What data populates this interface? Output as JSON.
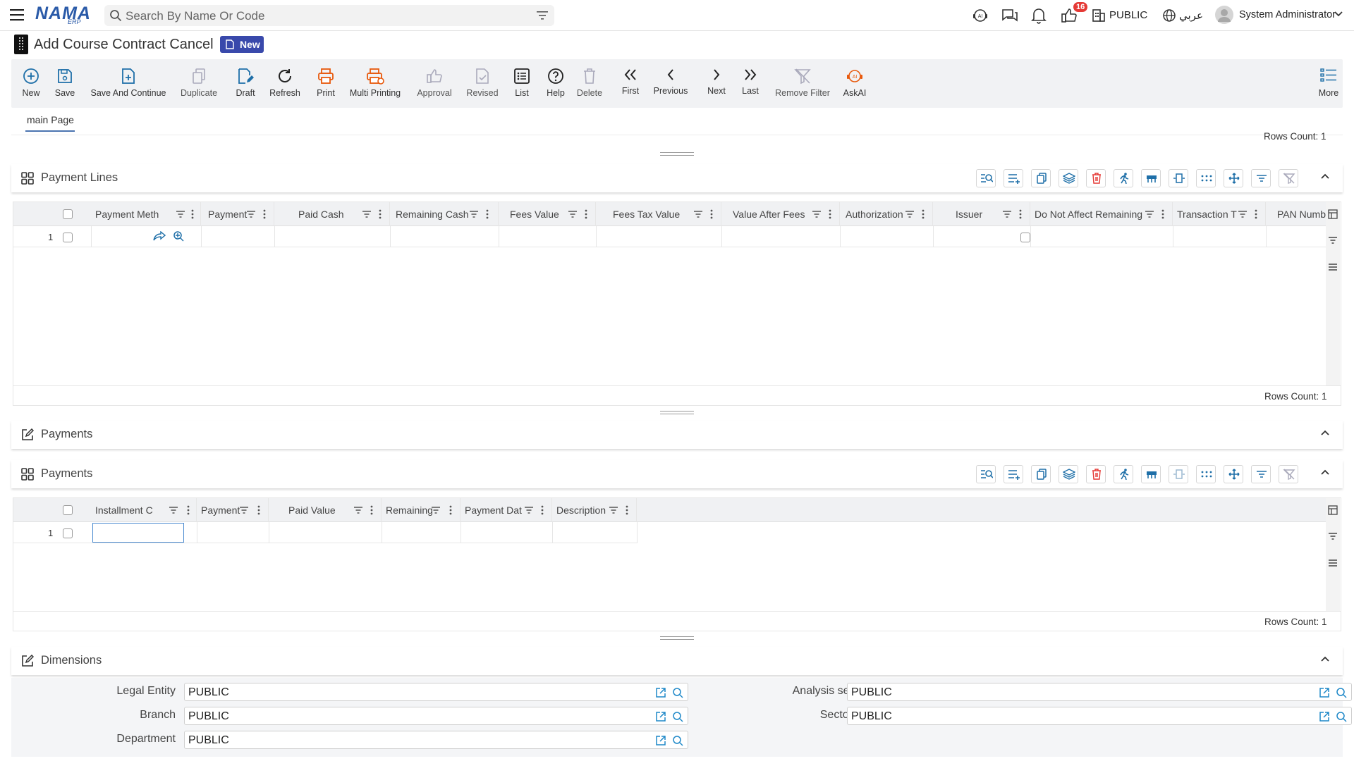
{
  "topbar": {
    "brand": "NAMA",
    "brand_sub": "ERP",
    "search_placeholder": "Search By Name Or Code",
    "notifications_count": "16",
    "company": "PUBLIC",
    "language": "عربي",
    "user": "System Administrator"
  },
  "page": {
    "title": "Add Course Contract Cancel",
    "status_badge": "New"
  },
  "toolbar": [
    {
      "label": "New",
      "icon": "plus-circle-icon",
      "enabled": true
    },
    {
      "label": "Save",
      "icon": "save-icon",
      "enabled": true
    },
    {
      "label": "Save And Continue",
      "icon": "file-plus-icon",
      "enabled": true
    },
    {
      "label": "Duplicate",
      "icon": "duplicate-icon",
      "enabled": false
    },
    {
      "label": "Draft",
      "icon": "draft-icon",
      "enabled": true
    },
    {
      "label": "Refresh",
      "icon": "refresh-icon",
      "enabled": true
    },
    {
      "label": "Print",
      "icon": "print-icon",
      "enabled": true
    },
    {
      "label": "Multi Printing",
      "icon": "multi-print-icon",
      "enabled": true
    },
    {
      "label": "Approval",
      "icon": "thumbs-up-icon",
      "enabled": false
    },
    {
      "label": "Revised",
      "icon": "revised-icon",
      "enabled": false
    },
    {
      "label": "List",
      "icon": "list-icon",
      "enabled": true
    },
    {
      "label": "Help",
      "icon": "help-icon",
      "enabled": true
    },
    {
      "label": "Delete",
      "icon": "trash-icon",
      "enabled": false
    },
    {
      "label": "First",
      "icon": "chevrons-left-icon",
      "enabled": true
    },
    {
      "label": "Previous",
      "icon": "chevron-left-icon",
      "enabled": true
    },
    {
      "label": "Next",
      "icon": "chevron-right-icon",
      "enabled": true
    },
    {
      "label": "Last",
      "icon": "chevrons-right-icon",
      "enabled": true
    },
    {
      "label": "Remove Filter",
      "icon": "filter-off-icon",
      "enabled": false
    },
    {
      "label": "AskAI",
      "icon": "ai-icon",
      "enabled": true
    },
    {
      "label": "More",
      "icon": "more-list-icon",
      "enabled": true
    }
  ],
  "tabs": [
    {
      "label": "main Page"
    }
  ],
  "rows_count_label": "Rows Count: 1",
  "payment_lines": {
    "title": "Payment Lines",
    "columns": [
      "Payment Meth",
      "Payment",
      "Paid Cash",
      "Remaining Cash",
      "Fees Value",
      "Fees Tax Value",
      "Value After Fees",
      "Authorization",
      "Issuer",
      "Do Not Affect Remaining",
      "Transaction T",
      "PAN Number"
    ],
    "row_number": "1",
    "rows_count": "Rows Count: 1"
  },
  "payments_section": {
    "title": "Payments"
  },
  "payments_grid": {
    "title": "Payments",
    "columns": [
      "Installment C",
      "Payment",
      "Paid Value",
      "Remaining",
      "Payment Dat",
      "Description"
    ],
    "row_number": "1",
    "rows_count": "Rows Count: 1"
  },
  "dimensions": {
    "title": "Dimensions",
    "fields": [
      {
        "label": "Legal Entity",
        "value": "PUBLIC"
      },
      {
        "label": "Analysis set",
        "value": "PUBLIC"
      },
      {
        "label": "Branch",
        "value": "PUBLIC"
      },
      {
        "label": "Sector",
        "value": "PUBLIC"
      },
      {
        "label": "Department",
        "value": "PUBLIC"
      }
    ]
  },
  "colors": {
    "brand": "#2a5aa8",
    "accent": "#3949ab",
    "print_orange": "#e8590c",
    "grid_tool_blue": "#1e6fa8"
  }
}
